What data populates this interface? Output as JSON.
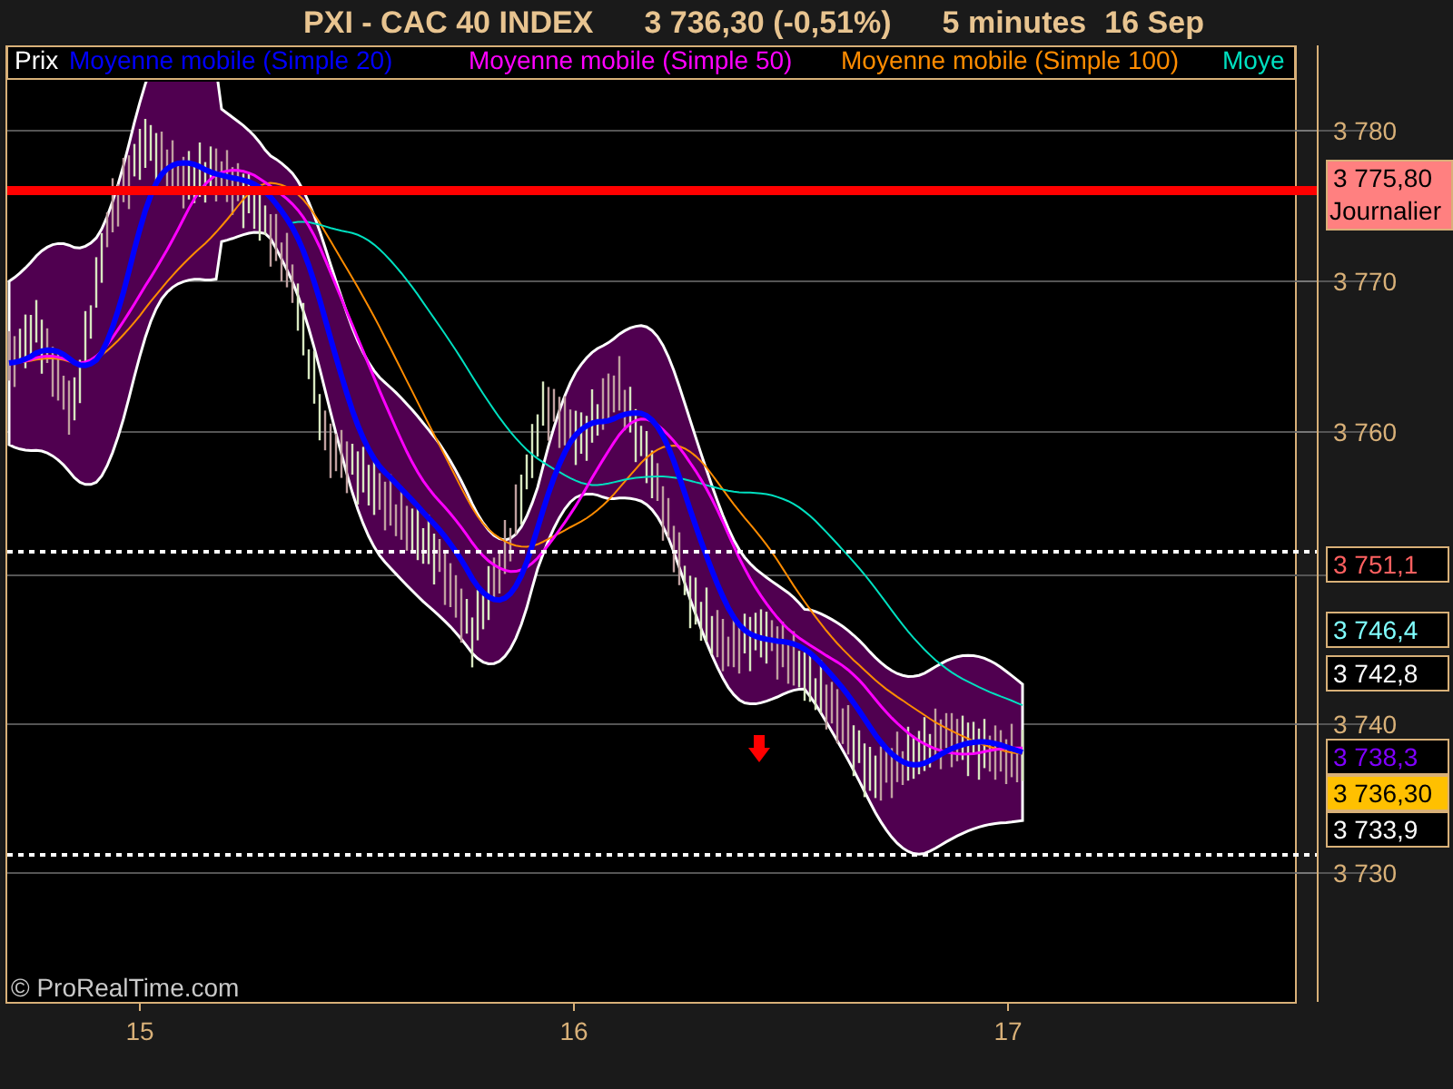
{
  "title": {
    "symbol": "PXI - CAC 40 INDEX",
    "quote": "3 736,30 (-0,51%)",
    "interval": "5 minutes",
    "date": "16 Sep"
  },
  "legend": [
    {
      "label": "Prix",
      "color": "#ffffff"
    },
    {
      "label": "Moyenne mobile (Simple 20)",
      "color": "#0000ff"
    },
    {
      "label": "Moyenne mobile (Simple 50)",
      "color": "#ff00ff"
    },
    {
      "label": "Moyenne mobile (Simple 100)",
      "color": "#ff8c00"
    },
    {
      "label": "Moye",
      "color": "#00e0c0"
    }
  ],
  "y_axis": [
    "3 780",
    "3 770",
    "3 760",
    "3 740",
    "3 730"
  ],
  "x_axis": [
    "15",
    "16",
    "17"
  ],
  "price_tags": [
    {
      "kind": "filled",
      "text": "3 775,80",
      "sublabel": "Journalier",
      "color": "#ff8080"
    },
    {
      "kind": "outlined",
      "text": "3 751,1",
      "color": "#ff6060"
    },
    {
      "kind": "outlined",
      "text": "3 746,4",
      "color": "#80ffff"
    },
    {
      "kind": "outlined",
      "text": "3 742,8",
      "color": "#ffffff"
    },
    {
      "kind": "outlined",
      "text": "3 738,3",
      "color": "#8000ff"
    },
    {
      "kind": "filled",
      "text": "3 736,30",
      "color": "#ffc000"
    },
    {
      "kind": "outlined",
      "text": "3 733,9",
      "color": "#ffffff"
    }
  ],
  "copyright": "© ProRealTime.com"
}
